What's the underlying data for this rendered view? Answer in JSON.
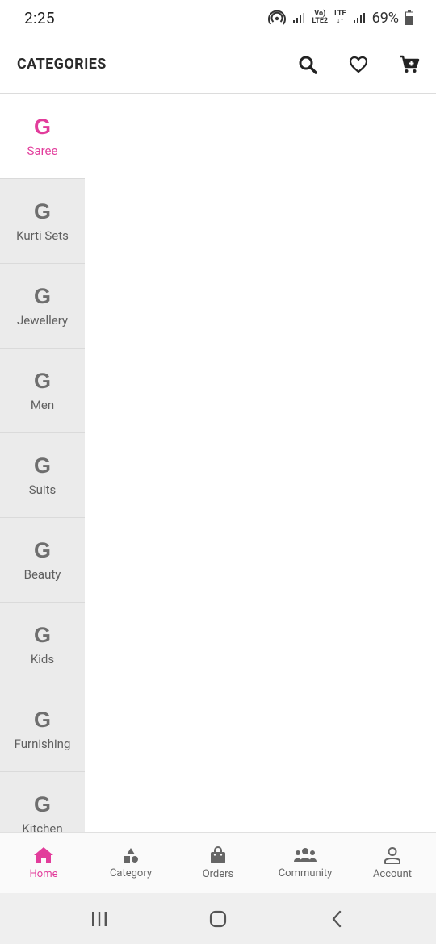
{
  "status_bar": {
    "time": "2:25",
    "lte_top": "Vo)",
    "lte_bottom": "LTE2",
    "lte2_top": "LTE",
    "lte2_bottom": "↓↑",
    "battery": "69%"
  },
  "header": {
    "title": "CATEGORIES",
    "icons": [
      "search-icon",
      "heart-icon",
      "cart-add-icon"
    ]
  },
  "sidebar": {
    "items": [
      {
        "icon": "G",
        "label": "Saree",
        "active": true
      },
      {
        "icon": "G",
        "label": "Kurti Sets",
        "active": false
      },
      {
        "icon": "G",
        "label": "Jewellery",
        "active": false
      },
      {
        "icon": "G",
        "label": "Men",
        "active": false
      },
      {
        "icon": "G",
        "label": "Suits",
        "active": false
      },
      {
        "icon": "G",
        "label": "Beauty",
        "active": false
      },
      {
        "icon": "G",
        "label": "Kids",
        "active": false
      },
      {
        "icon": "G",
        "label": "Furnishing",
        "active": false
      },
      {
        "icon": "G",
        "label": "Kitchen",
        "active": false
      }
    ]
  },
  "bottom_nav": {
    "items": [
      {
        "label": "Home",
        "icon": "home-icon",
        "active": true
      },
      {
        "label": "Category",
        "icon": "category-icon",
        "active": false
      },
      {
        "label": "Orders",
        "icon": "bag-icon",
        "active": false
      },
      {
        "label": "Community",
        "icon": "community-icon",
        "active": false
      },
      {
        "label": "Account",
        "icon": "account-icon",
        "active": false
      }
    ]
  },
  "colors": {
    "accent": "#e23c9b",
    "sidebar_bg": "#ebebeb",
    "inactive": "#666666"
  }
}
